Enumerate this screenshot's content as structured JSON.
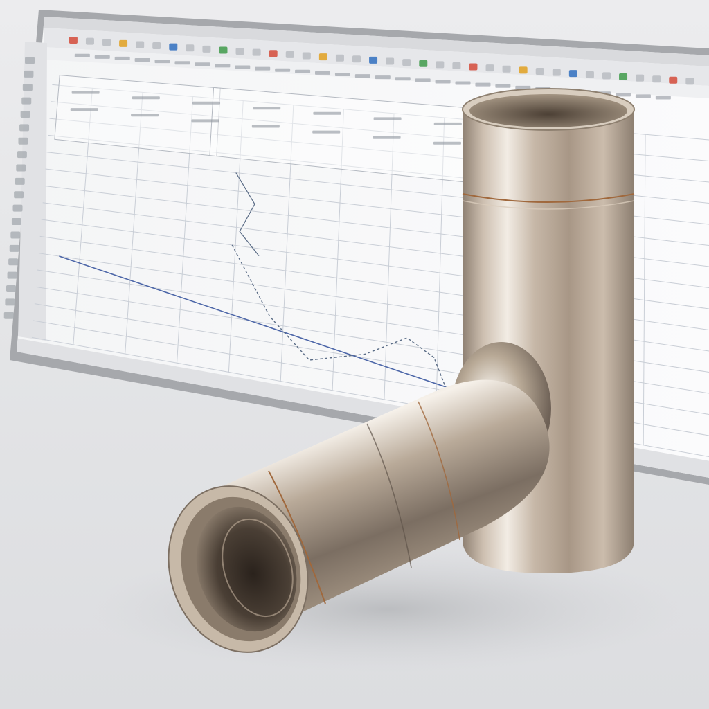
{
  "scene": {
    "description_free": true,
    "background_color": "#e3e4e6",
    "monitor_frame_color": "#9a9ca0",
    "screen_color": "#f7f8f9",
    "toolbar_color": "#dcdde0",
    "grid_color": "#c9ced6",
    "curve_color": "#5a6c86",
    "axis_line_color": "#4c66a8",
    "accent_colors": [
      "#d44a3a",
      "#3e9a4a",
      "#2f6fc0",
      "#e0a020"
    ],
    "pipe_base_color": "#b9aa99",
    "pipe_highlight_color": "#f4efe8",
    "pipe_shadow_color": "#6d6156",
    "pipe_inner_color": "#3b3128",
    "pipe_seam_color": "#a0683c"
  }
}
